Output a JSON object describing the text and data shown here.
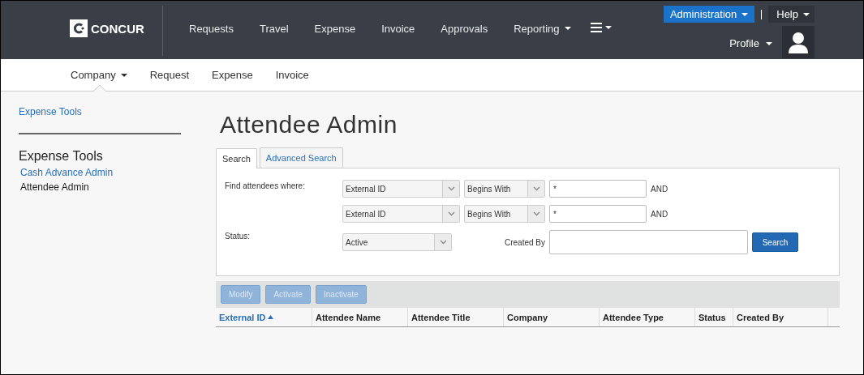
{
  "header": {
    "logo": "CONCUR",
    "nav": [
      {
        "label": "Requests",
        "dropdown": false
      },
      {
        "label": "Travel",
        "dropdown": false
      },
      {
        "label": "Expense",
        "dropdown": false
      },
      {
        "label": "Invoice",
        "dropdown": false
      },
      {
        "label": "Approvals",
        "dropdown": false
      },
      {
        "label": "Reporting",
        "dropdown": true
      }
    ],
    "administration": "Administration",
    "help": "Help",
    "profile": "Profile"
  },
  "subnav": [
    {
      "label": "Company",
      "dropdown": true,
      "selected": true
    },
    {
      "label": "Request",
      "dropdown": false,
      "selected": false
    },
    {
      "label": "Expense",
      "dropdown": false,
      "selected": false
    },
    {
      "label": "Invoice",
      "dropdown": false,
      "selected": false
    }
  ],
  "sidebar": {
    "top_link": "Expense Tools",
    "heading": "Expense Tools",
    "items": [
      {
        "label": "Cash Advance Admin",
        "selected": false
      },
      {
        "label": "Attendee Admin",
        "selected": true
      }
    ]
  },
  "page_title": "Attendee Admin",
  "tabs": [
    {
      "label": "Search",
      "selected": true
    },
    {
      "label": "Advanced Search",
      "selected": false
    }
  ],
  "search_form": {
    "find_label": "Find attendees where:",
    "criteria": [
      {
        "field": "External ID",
        "operator": "Begins With",
        "value": "*",
        "joiner": "AND"
      },
      {
        "field": "External ID",
        "operator": "Begins With",
        "value": "*",
        "joiner": "AND"
      }
    ],
    "status_label": "Status:",
    "status": "Active",
    "created_by_label": "Created By",
    "search_button": "Search"
  },
  "actions": [
    {
      "label": "Modify",
      "disabled": true
    },
    {
      "label": "Activate",
      "disabled": true
    },
    {
      "label": "Inactivate",
      "disabled": true
    }
  ],
  "table": {
    "columns": [
      {
        "label": "External ID",
        "sorted": true
      },
      {
        "label": "Attendee Name",
        "sorted": false
      },
      {
        "label": "Attendee Title",
        "sorted": false
      },
      {
        "label": "Company",
        "sorted": false
      },
      {
        "label": "Attendee Type",
        "sorted": false
      },
      {
        "label": "Status",
        "sorted": false
      },
      {
        "label": "Created By",
        "sorted": false
      }
    ]
  }
}
